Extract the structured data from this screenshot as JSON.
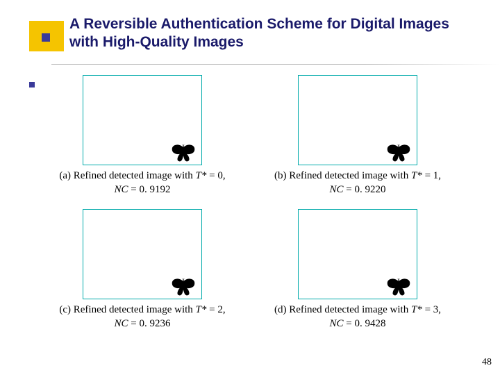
{
  "slide": {
    "title": "A Reversible Authentication Scheme for Digital Images with High-Quality Images",
    "number": "48"
  },
  "panels": {
    "a": {
      "prefix": "(a) Refined detected image with ",
      "param": "T*",
      "eq": " = 0,",
      "nc_label": "NC",
      "nc_value": " = 0. 9192"
    },
    "b": {
      "prefix": "(b) Refined detected image with ",
      "param": "T*",
      "eq": " = 1,",
      "nc_label": "NC",
      "nc_value": " = 0. 9220"
    },
    "c": {
      "prefix": "(c) Refined detected image with ",
      "param": "T*",
      "eq": " = 2,",
      "nc_label": "NC",
      "nc_value": " = 0. 9236"
    },
    "d": {
      "prefix": "(d) Refined detected image with ",
      "param": "T*",
      "eq": " = 3,",
      "nc_label": "NC",
      "nc_value": " = 0. 9428"
    }
  },
  "chart_data": {
    "type": "table",
    "title": "Refined detected image NC vs T*",
    "columns": [
      "T*",
      "NC"
    ],
    "rows": [
      [
        0,
        0.9192
      ],
      [
        1,
        0.922
      ],
      [
        2,
        0.9236
      ],
      [
        3,
        0.9428
      ]
    ]
  }
}
